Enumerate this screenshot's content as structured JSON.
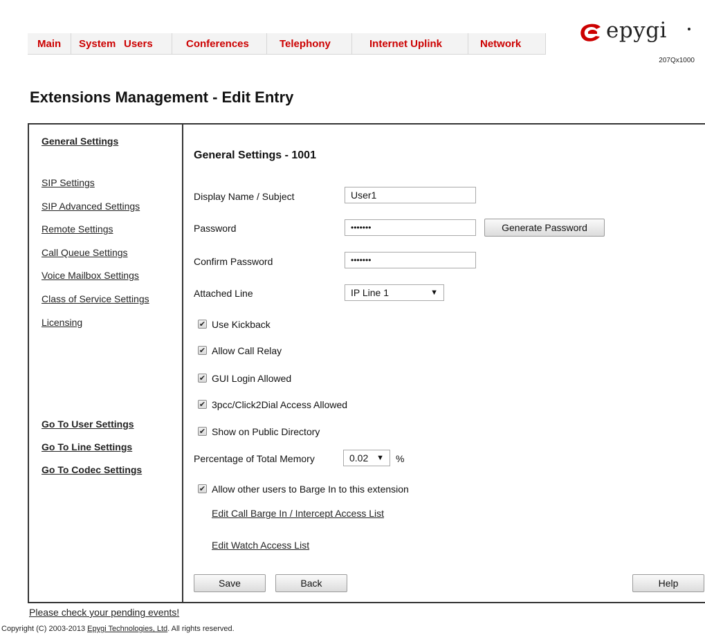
{
  "nav": {
    "tabs": [
      "Main",
      "System",
      "Users",
      "Conferences",
      "Telephony",
      "Internet Uplink",
      "Network"
    ]
  },
  "logo": {
    "brand": "epygi",
    "model": "207Qx1000"
  },
  "page": {
    "title": "Extensions Management - Edit Entry"
  },
  "sidebar": {
    "items": [
      "General Settings",
      "SIP Settings",
      "SIP Advanced Settings",
      "Remote Settings",
      "Call Queue Settings",
      "Voice Mailbox Settings",
      "Class of Service Settings",
      "Licensing"
    ],
    "goto": [
      "Go To User Settings",
      "Go To Line Settings",
      "Go To Codec Settings"
    ]
  },
  "form": {
    "section_title": "General Settings - 1001",
    "display_name": {
      "label": "Display Name / Subject",
      "value": "User1"
    },
    "password": {
      "label": "Password",
      "value": "•••••••"
    },
    "confirm_password": {
      "label": "Confirm Password",
      "value": "•••••••"
    },
    "generate_password": "Generate Password",
    "attached_line": {
      "label": "Attached Line",
      "value": "IP Line 1"
    },
    "checkboxes": [
      {
        "label": "Use Kickback",
        "checked": true
      },
      {
        "label": "Allow Call Relay",
        "checked": true
      },
      {
        "label": "GUI Login Allowed",
        "checked": true
      },
      {
        "label": "3pcc/Click2Dial Access Allowed",
        "checked": true
      },
      {
        "label": "Show on Public Directory",
        "checked": true
      }
    ],
    "memory": {
      "label": "Percentage of Total Memory",
      "value": "0.02",
      "unit": "%"
    },
    "barge_in": {
      "label": "Allow other users to Barge In to this extension",
      "checked": true
    },
    "links": [
      "Edit Call Barge In / Intercept Access List",
      "Edit Watch Access List"
    ],
    "buttons": {
      "save": "Save",
      "back": "Back",
      "help": "Help"
    }
  },
  "footer": {
    "pending": "Please check your pending events!",
    "copyright_prefix": "Copyright (C) 2003-2013 ",
    "copyright_link": "Epygi Technologies, Ltd",
    "copyright_suffix": ". All rights reserved."
  },
  "colors": {
    "nav_text": "#cc0000",
    "logo_red": "#cc0000"
  },
  "icons": {
    "check": "checkmark-icon",
    "dropdown": "chevron-down-icon"
  }
}
